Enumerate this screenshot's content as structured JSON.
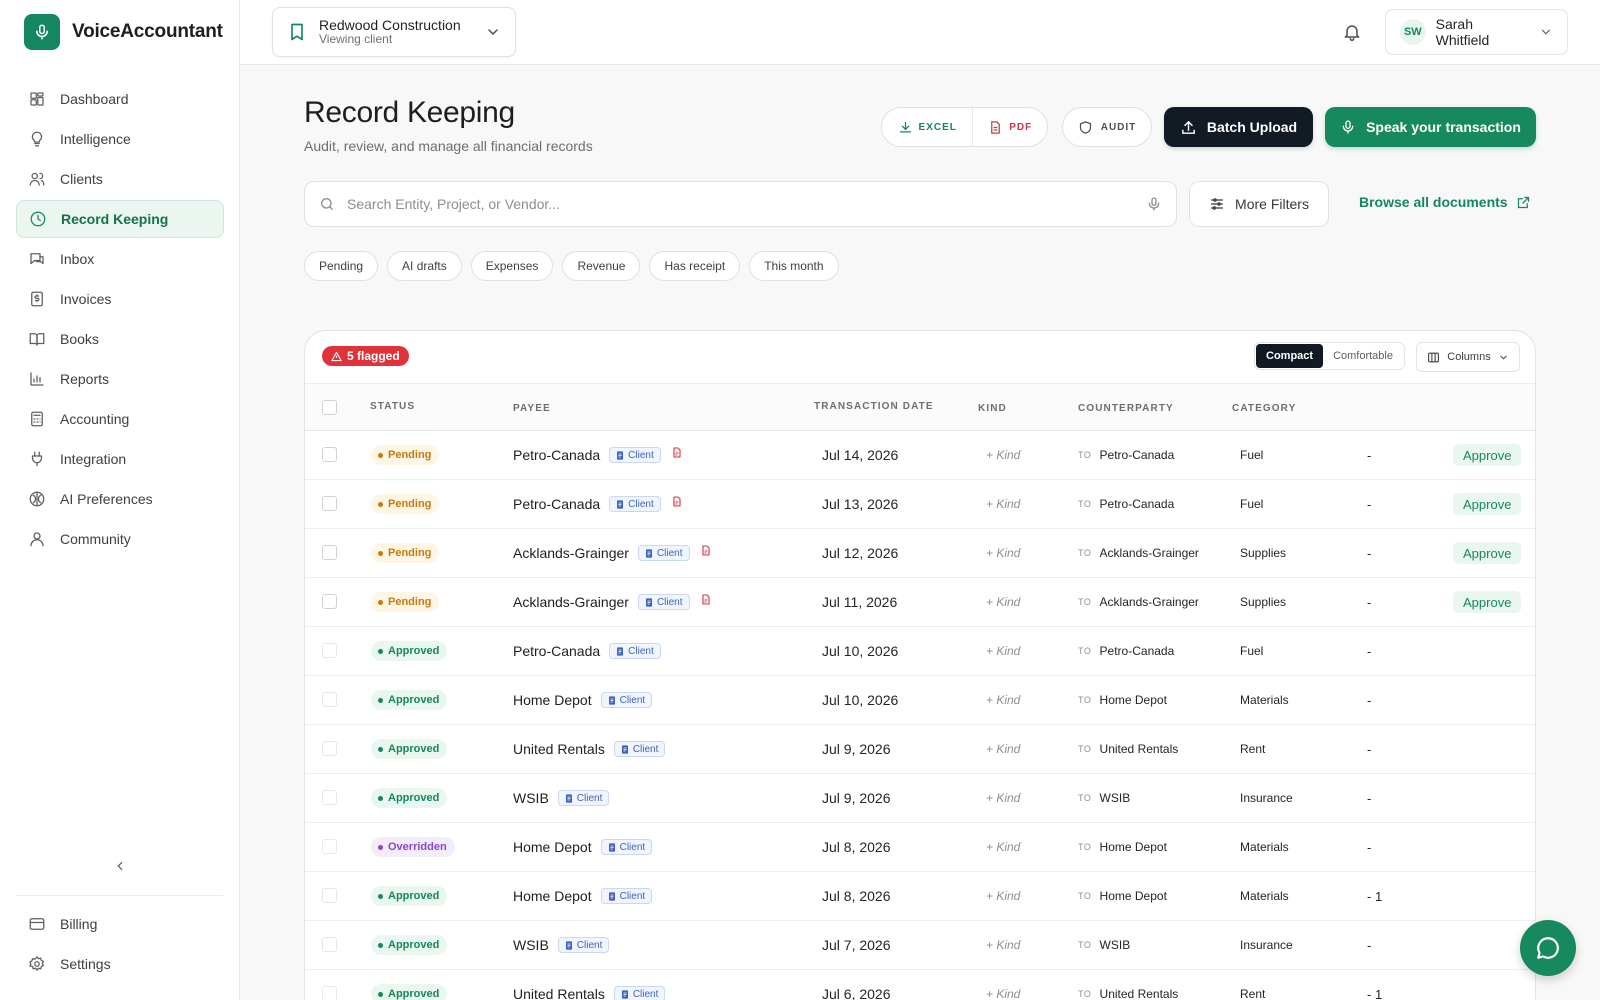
{
  "brand": {
    "name": "VoiceAccountant"
  },
  "nav": [
    {
      "label": "Dashboard",
      "icon": "dashboard-icon",
      "active": false
    },
    {
      "label": "Intelligence",
      "icon": "lightbulb-icon",
      "active": false
    },
    {
      "label": "Clients",
      "icon": "users-icon",
      "active": false
    },
    {
      "label": "Record Keeping",
      "icon": "clock-icon",
      "active": true
    },
    {
      "label": "Inbox",
      "icon": "inbox-icon",
      "active": false
    },
    {
      "label": "Invoices",
      "icon": "invoice-icon",
      "active": false
    },
    {
      "label": "Books",
      "icon": "book-icon",
      "active": false
    },
    {
      "label": "Reports",
      "icon": "bar-chart-icon",
      "active": false
    },
    {
      "label": "Accounting",
      "icon": "calculator-icon",
      "active": false
    },
    {
      "label": "Integration",
      "icon": "plug-icon",
      "active": false
    },
    {
      "label": "AI Preferences",
      "icon": "brain-icon",
      "active": false
    },
    {
      "label": "Community",
      "icon": "community-icon",
      "active": false
    }
  ],
  "nav_bottom": [
    {
      "label": "Billing",
      "icon": "credit-card-icon"
    },
    {
      "label": "Settings",
      "icon": "gear-icon"
    }
  ],
  "topbar": {
    "client_name": "Redwood Construction",
    "client_sub": "Viewing client",
    "user_initials": "SW",
    "user_name": "Sarah Whitfield"
  },
  "header": {
    "title": "Record Keeping",
    "subtitle": "Audit, review, and manage all financial records",
    "excel_label": "EXCEL",
    "pdf_label": "PDF",
    "audit_label": "AUDIT",
    "batch_label": "Batch Upload",
    "speak_label": "Speak your transaction"
  },
  "search": {
    "placeholder": "Search Entity, Project, or Vendor...",
    "filters_label": "More Filters",
    "browse_label": "Browse all documents"
  },
  "chips": [
    "Pending",
    "AI drafts",
    "Expenses",
    "Revenue",
    "Has receipt",
    "This month"
  ],
  "table": {
    "flagged_label": "5 flagged",
    "density_compact": "Compact",
    "density_comfortable": "Comfortable",
    "columns_label": "Columns",
    "headers": {
      "status": "STATUS",
      "payee": "PAYEE",
      "date": "TRANSACTION DATE",
      "kind": "KIND",
      "counterparty": "COUNTERPARTY",
      "category": "CATEGORY"
    },
    "client_tag": "Client",
    "kind_placeholder": "+ Kind",
    "to_label": "TO",
    "approve_label": "Approve",
    "rows": [
      {
        "status": "Pending",
        "payee": "Petro-Canada",
        "receipt": true,
        "date": "Jul 14, 2026",
        "counterparty": "Petro-Canada",
        "category": "Fuel",
        "amount": "-",
        "approve": true
      },
      {
        "status": "Pending",
        "payee": "Petro-Canada",
        "receipt": true,
        "date": "Jul 13, 2026",
        "counterparty": "Petro-Canada",
        "category": "Fuel",
        "amount": "-",
        "approve": true
      },
      {
        "status": "Pending",
        "payee": "Acklands-Grainger",
        "receipt": true,
        "date": "Jul 12, 2026",
        "counterparty": "Acklands-Grainger",
        "category": "Supplies",
        "amount": "-",
        "approve": true
      },
      {
        "status": "Pending",
        "payee": "Acklands-Grainger",
        "receipt": true,
        "date": "Jul 11, 2026",
        "counterparty": "Acklands-Grainger",
        "category": "Supplies",
        "amount": "-",
        "approve": true
      },
      {
        "status": "Approved",
        "payee": "Petro-Canada",
        "receipt": false,
        "date": "Jul 10, 2026",
        "counterparty": "Petro-Canada",
        "category": "Fuel",
        "amount": "-",
        "approve": false
      },
      {
        "status": "Approved",
        "payee": "Home Depot",
        "receipt": false,
        "date": "Jul 10, 2026",
        "counterparty": "Home Depot",
        "category": "Materials",
        "amount": "-",
        "approve": false
      },
      {
        "status": "Approved",
        "payee": "United Rentals",
        "receipt": false,
        "date": "Jul 9, 2026",
        "counterparty": "United Rentals",
        "category": "Rent",
        "amount": "-",
        "approve": false
      },
      {
        "status": "Approved",
        "payee": "WSIB",
        "receipt": false,
        "date": "Jul 9, 2026",
        "counterparty": "WSIB",
        "category": "Insurance",
        "amount": "-",
        "approve": false
      },
      {
        "status": "Overridden",
        "payee": "Home Depot",
        "receipt": false,
        "date": "Jul 8, 2026",
        "counterparty": "Home Depot",
        "category": "Materials",
        "amount": "-",
        "approve": false
      },
      {
        "status": "Approved",
        "payee": "Home Depot",
        "receipt": false,
        "date": "Jul 8, 2026",
        "counterparty": "Home Depot",
        "category": "Materials",
        "amount": "- 1",
        "approve": false
      },
      {
        "status": "Approved",
        "payee": "WSIB",
        "receipt": false,
        "date": "Jul 7, 2026",
        "counterparty": "WSIB",
        "category": "Insurance",
        "amount": "-",
        "approve": false
      },
      {
        "status": "Approved",
        "payee": "United Rentals",
        "receipt": false,
        "date": "Jul 6, 2026",
        "counterparty": "United Rentals",
        "category": "Rent",
        "amount": "- 1",
        "approve": false
      }
    ]
  },
  "colors": {
    "accent": "#17895f",
    "dark": "#121a24",
    "flag": "#e0323a",
    "pending": "#c77b0a",
    "overridden": "#8a45c9"
  }
}
